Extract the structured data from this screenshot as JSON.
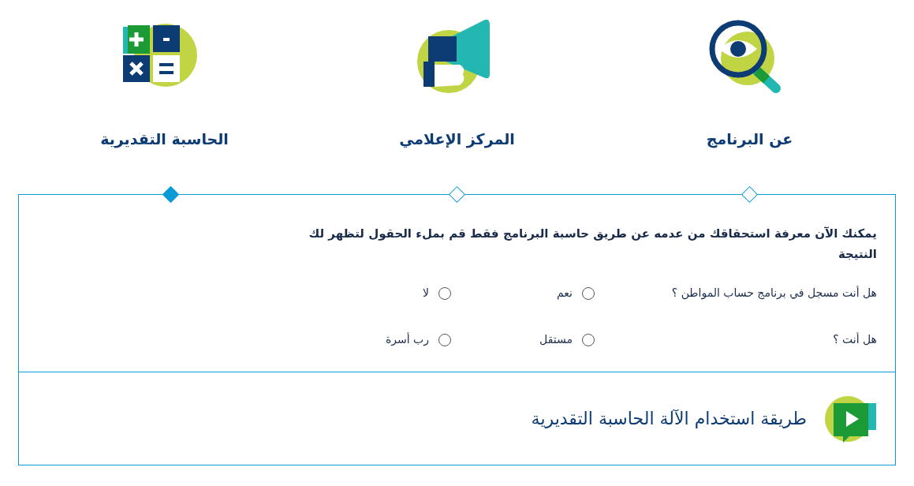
{
  "tabs": [
    {
      "label": "عن البرنامج",
      "kind": "magnifier",
      "selected": false
    },
    {
      "label": "المركز الإعلامي",
      "kind": "megaphone",
      "selected": false
    },
    {
      "label": "الحاسبة التقديرية",
      "kind": "calculator",
      "selected": true
    }
  ],
  "intro": "يمكنك الآن معرفة استحقاقك من عدمه عن طريق حاسبة البرنامج فقط قم بملء الحقول لتظهر لك النتيجة",
  "questions": [
    {
      "label": "هل أنت مسجل في برنامج حساب المواطن ؟",
      "options": [
        {
          "label": "نعم",
          "selected": false
        },
        {
          "label": "لا",
          "selected": false
        }
      ]
    },
    {
      "label": "هل أنت ؟",
      "options": [
        {
          "label": "مستقل",
          "selected": false
        },
        {
          "label": "رب أسرة",
          "selected": false
        }
      ]
    }
  ],
  "video": {
    "title": "طريقة استخدام الآلة الحاسبة التقديرية"
  }
}
